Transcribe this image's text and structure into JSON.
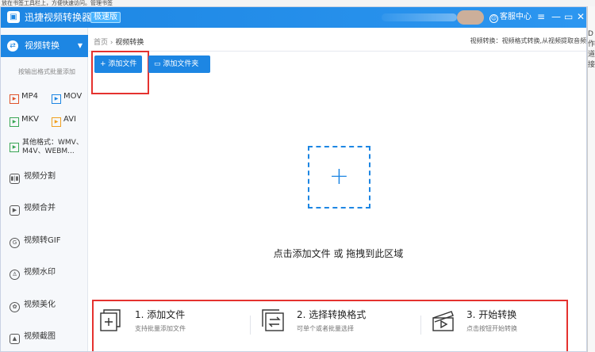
{
  "top_strip": {
    "text": "放在书签工具栏上，方便快速访问。管理书签"
  },
  "titlebar": {
    "app_title": "迅捷视频转换器",
    "badge": "极速版",
    "service_label": "客服中心",
    "menu_icon": "≡",
    "minimize_icon": "—",
    "maximize_icon": "▭",
    "close_icon": "✕"
  },
  "sidebar": {
    "active_item": "视频转换",
    "subheading": "按输出格式批量添加",
    "formats": [
      "MP4",
      "MOV",
      "MKV",
      "AVI"
    ],
    "other_formats": "其他格式：WMV、M4V、WEBM...",
    "items": [
      "视频分割",
      "视频合并",
      "视频转GIF",
      "视频水印",
      "视频美化",
      "视频截图"
    ]
  },
  "main": {
    "breadcrumb_home": "首页",
    "breadcrumb_sep": "›",
    "breadcrumb_current": "视频转换",
    "info": "视频转换：视频格式转换,从视频提取音频",
    "add_file_label": "添加文件",
    "add_folder_label": "添加文件夹",
    "drop_text": "点击添加文件 或 拖拽到此区域",
    "steps": [
      {
        "title": "1. 添加文件",
        "desc": "支持批量添加文件"
      },
      {
        "title": "2. 选择转换格式",
        "desc": "可单个或者批量选择"
      },
      {
        "title": "3. 开始转换",
        "desc": "点击按钮开始转换"
      }
    ]
  },
  "right_edge": {
    "text": "D 作 道 接"
  },
  "colors": {
    "accent": "#1d86e3",
    "highlight": "#e5322f"
  }
}
